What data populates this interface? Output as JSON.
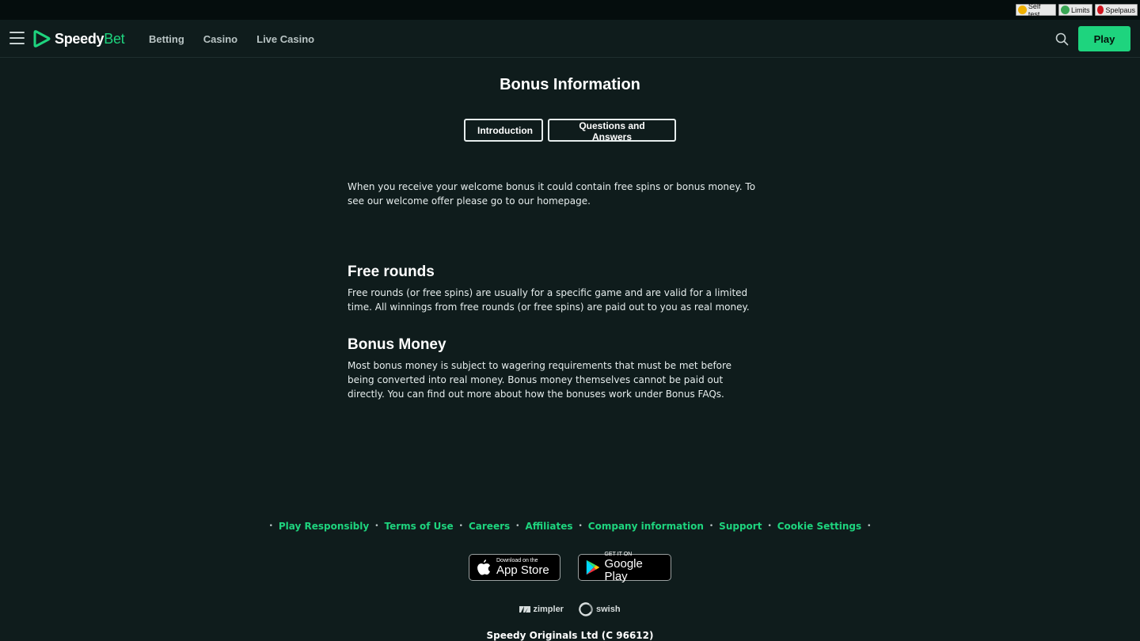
{
  "rg_bar": {
    "items": [
      {
        "label": "Self test",
        "icon": "self-test-icon",
        "color": "#f0b000"
      },
      {
        "label": "Limits",
        "icon": "limits-icon",
        "color": "#3aa655"
      },
      {
        "label": "Spelpaus",
        "icon": "spelpaus-icon",
        "color": "#d0141e"
      }
    ]
  },
  "header": {
    "logo_main": "Speedy",
    "logo_accent": "Bet",
    "nav": [
      "Betting",
      "Casino",
      "Live Casino"
    ],
    "play_label": "Play"
  },
  "page": {
    "title": "Bonus Information",
    "tabs": [
      "Introduction",
      "Questions and Answers"
    ],
    "intro": "When you receive your welcome bonus it could contain free spins or bonus money. To see our welcome offer please go to our homepage.",
    "sections": [
      {
        "heading": "Free rounds",
        "text": "Free rounds (or free spins) are usually for a specific game and are valid for a limited time. All winnings from free rounds (or free spins) are paid out to you as real money."
      },
      {
        "heading": "Bonus Money",
        "text": "Most bonus money is subject to wagering requirements that must be met before being converted into real money. Bonus money themselves cannot be paid out directly. You can find out more about how the bonuses work under Bonus FAQs."
      }
    ]
  },
  "footer": {
    "links": [
      "Play Responsibly",
      "Terms of Use",
      "Careers",
      "Affiliates",
      "Company information",
      "Support",
      "Cookie Settings"
    ],
    "app_store": {
      "small": "Download on the",
      "big": "App Store"
    },
    "google_play": {
      "small": "GET IT ON",
      "big": "Google Play"
    },
    "payments": [
      "zimpler",
      "swish"
    ],
    "company": "Speedy Originals Ltd (C 96612)"
  },
  "colors": {
    "background": "#0f1c1c",
    "accent": "#1ed47e"
  }
}
